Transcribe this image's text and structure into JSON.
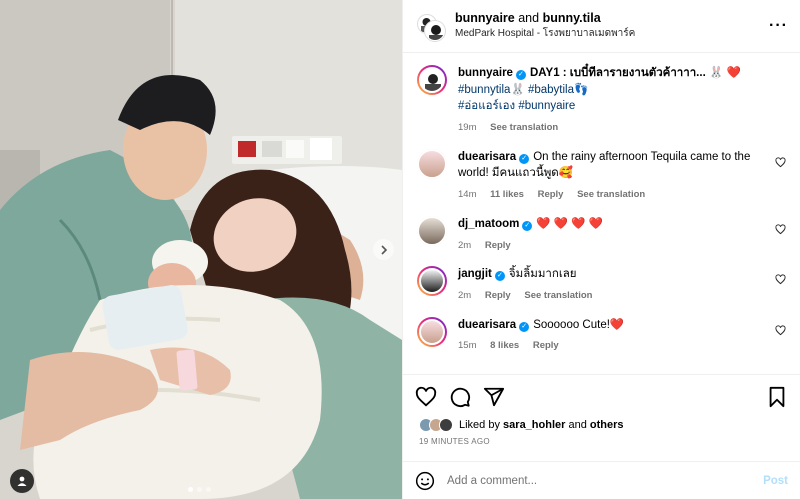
{
  "header": {
    "user1": "bunnyaire",
    "joiner": "and",
    "user2": "bunny.tila",
    "location": "MedPark Hospital - โรงพยาบาลเมดพาร์ค",
    "more_icon": "more-horizontal-icon"
  },
  "caption": {
    "user": "bunnyaire",
    "text": "DAY1 : เบบี๋ทีลารายงานตัวค้าาาา...",
    "emojis": "🐰 ❤️",
    "tag1": "#bunnytila",
    "tag1_emoji": "🐰",
    "tag2": "#babytila",
    "tag2_emoji": "👣",
    "tag3": "#อ่อแอร์เอง",
    "tag4": "#bunnyaire",
    "time": "19m",
    "see_translation": "See translation"
  },
  "comments": [
    {
      "user": "duearisara",
      "verified": true,
      "text": "On the rainy afternoon Tequila came to the world! มีคนแถวนี้พูด",
      "emoji": "🥰",
      "time": "14m",
      "likes": "11 likes",
      "reply": "Reply",
      "translation": "See translation"
    },
    {
      "user": "dj_matoom",
      "verified": true,
      "text": "❤️ ❤️ ❤️ ❤️",
      "time": "2m",
      "reply": "Reply"
    },
    {
      "user": "jangjit",
      "verified": true,
      "text": "จิ้มลิ้มมากเลย",
      "time": "2m",
      "reply": "Reply",
      "translation": "See translation"
    },
    {
      "user": "duearisara",
      "verified": true,
      "text": "Soooooo Cute!",
      "emoji": "❤️",
      "time": "15m",
      "likes": "8 likes",
      "reply": "Reply"
    }
  ],
  "likes": {
    "prefix": "Liked by",
    "user": "sara_hohler",
    "joiner": "and",
    "others": "others",
    "time_ago": "19 MINUTES AGO"
  },
  "add_comment": {
    "placeholder": "Add a comment...",
    "post": "Post"
  },
  "colors": {
    "link_blue": "#00376b",
    "verified_blue": "#0095f6",
    "post_disabled": "#b2dffc",
    "heart_red": "#ed1e33"
  },
  "carousel": {
    "current_image": 1,
    "total_images": 3
  }
}
